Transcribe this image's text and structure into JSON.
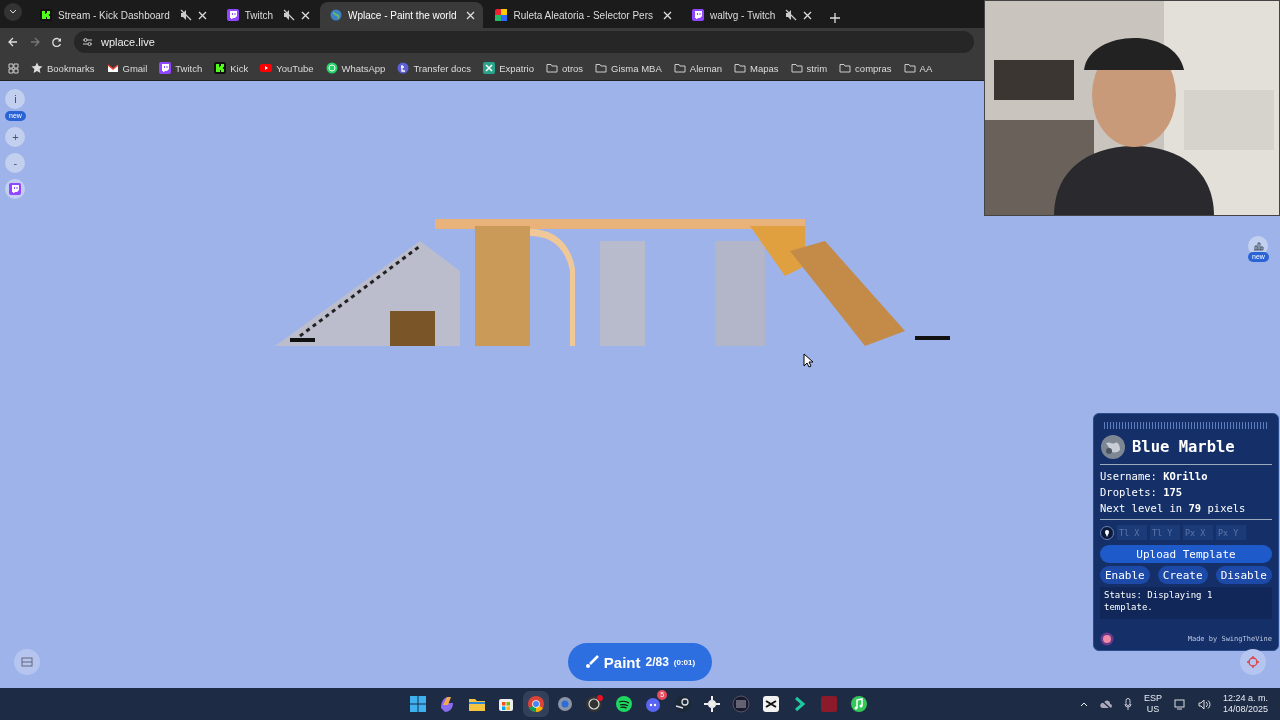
{
  "tabs": [
    {
      "label": "Stream - Kick Dashboard",
      "kind": "kick",
      "muted": true,
      "selected": false
    },
    {
      "label": "Twitch",
      "kind": "twitch",
      "muted": true,
      "selected": false
    },
    {
      "label": "Wplace - Paint the world",
      "kind": "globe",
      "muted": false,
      "selected": true
    },
    {
      "label": "Ruleta Aleatoria - Selector Pers",
      "kind": "wheel",
      "muted": false,
      "selected": false
    },
    {
      "label": "waltvg - Twitch",
      "kind": "twitch",
      "muted": true,
      "selected": false
    }
  ],
  "address_bar": {
    "url": "wplace.live"
  },
  "bookmarks": [
    {
      "label": "Bookmarks",
      "kind": "star"
    },
    {
      "label": "Gmail",
      "kind": "gmail"
    },
    {
      "label": "Twitch",
      "kind": "twitch"
    },
    {
      "label": "Kick",
      "kind": "kick"
    },
    {
      "label": "YouTube",
      "kind": "youtube"
    },
    {
      "label": "WhatsApp",
      "kind": "whatsapp"
    },
    {
      "label": "Transfer docs",
      "kind": "tumblr"
    },
    {
      "label": "Expatrio",
      "kind": "expatrio"
    },
    {
      "label": "otros",
      "kind": "folder"
    },
    {
      "label": "Gisma MBA",
      "kind": "folder"
    },
    {
      "label": "Aleman",
      "kind": "folder"
    },
    {
      "label": "Mapas",
      "kind": "folder"
    },
    {
      "label": "strim",
      "kind": "folder"
    },
    {
      "label": "compras",
      "kind": "folder"
    },
    {
      "label": "AA",
      "kind": "folder"
    }
  ],
  "map_controls": [
    {
      "kind": "info",
      "label": "i",
      "badge": "new"
    },
    {
      "kind": "zoom",
      "label": "+"
    },
    {
      "kind": "zoom",
      "label": "-"
    },
    {
      "kind": "twitch"
    }
  ],
  "leaderboard_button": {
    "badge": "new"
  },
  "blue_marble": {
    "title": "Blue Marble",
    "stats": [
      "Username: **KOrillo**",
      "Droplets: **175**",
      "Next level in **79** pixels"
    ],
    "coordinates": [
      {
        "placeholder": "Tl X"
      },
      {
        "placeholder": "Tl Y"
      },
      {
        "placeholder": "Px X"
      },
      {
        "placeholder": "Px Y"
      }
    ],
    "upload_button": "Upload Template",
    "buttons": [
      "Enable",
      "Create",
      "Disable"
    ],
    "status": "Status: Displaying 1 template.",
    "credit": "Made by SwingTheVine"
  },
  "paint_button": {
    "label": "Paint",
    "count": "2/83",
    "timer": "(0:01)"
  },
  "taskbar": {
    "apps": [
      {
        "kind": "windows",
        "active": false
      },
      {
        "kind": "copilot",
        "active": false
      },
      {
        "kind": "explorer",
        "active": false
      },
      {
        "kind": "store",
        "active": false
      },
      {
        "kind": "chrome",
        "active": true
      },
      {
        "kind": "settings",
        "active": false
      },
      {
        "kind": "obs",
        "active": false
      },
      {
        "kind": "spotify",
        "active": false
      },
      {
        "kind": "discord",
        "active": false,
        "badge": "5"
      },
      {
        "kind": "steam",
        "active": false
      },
      {
        "kind": "steelseries",
        "active": false
      },
      {
        "kind": "grid",
        "active": false
      },
      {
        "kind": "capcut",
        "active": false
      },
      {
        "kind": "arrow",
        "active": false
      },
      {
        "kind": "red",
        "active": false
      },
      {
        "kind": "music",
        "active": false
      }
    ],
    "language": [
      "ESP",
      "US"
    ],
    "time": "12:24 a. m.",
    "date": "14/08/2025"
  }
}
